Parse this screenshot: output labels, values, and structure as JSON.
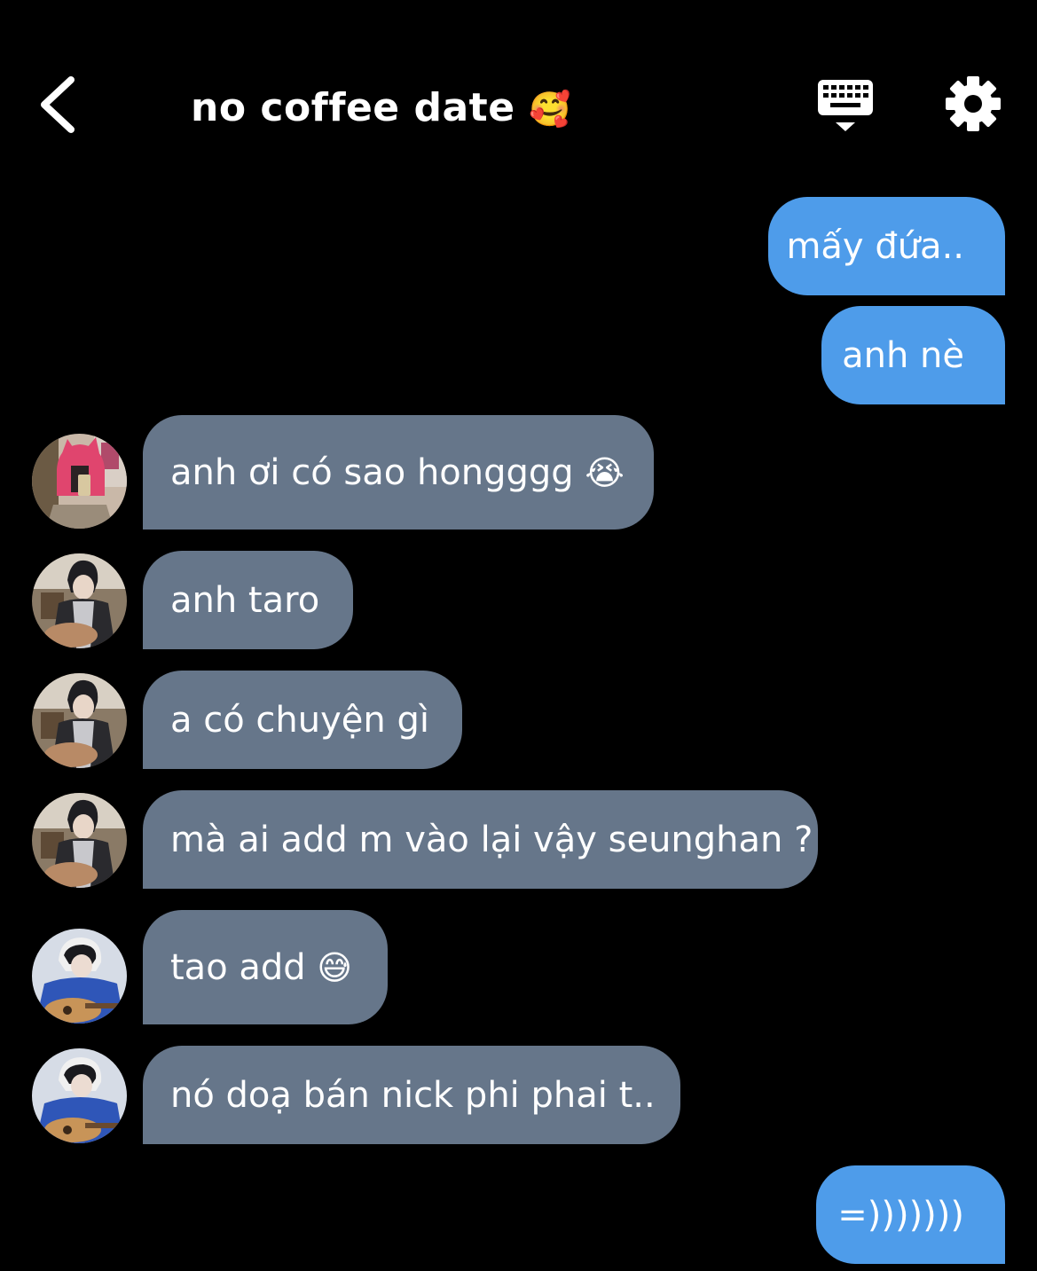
{
  "header": {
    "title": "no coffee date",
    "title_emoji": "🥰"
  },
  "messages": [
    {
      "side": "sent",
      "text": "mấy đứa.."
    },
    {
      "side": "sent",
      "text": "anh nè"
    },
    {
      "side": "recv",
      "text": "anh ơi có sao hongggg",
      "emoji": "😭",
      "avatar": "pink-hat"
    },
    {
      "side": "recv",
      "text": "anh taro",
      "avatar": "jacket"
    },
    {
      "side": "recv",
      "text": "a có chuyện gì",
      "avatar": "jacket"
    },
    {
      "side": "recv",
      "text": "mà ai add m vào lại vậy seunghan ?",
      "avatar": "jacket"
    },
    {
      "side": "recv",
      "text": "tao add",
      "emoji": "😅",
      "avatar": "guitar"
    },
    {
      "side": "recv",
      "text": "nó doạ bán nick phi phai t..",
      "avatar": "guitar"
    },
    {
      "side": "sent",
      "text": "=)))))))"
    }
  ],
  "colors": {
    "background": "#000000",
    "sent_bubble": "#4e9cea",
    "received_bubble": "#66768a",
    "text": "#ffffff"
  },
  "icons": {
    "back": "chevron-left-icon",
    "keyboard": "keyboard-icon",
    "settings": "gear-icon"
  }
}
